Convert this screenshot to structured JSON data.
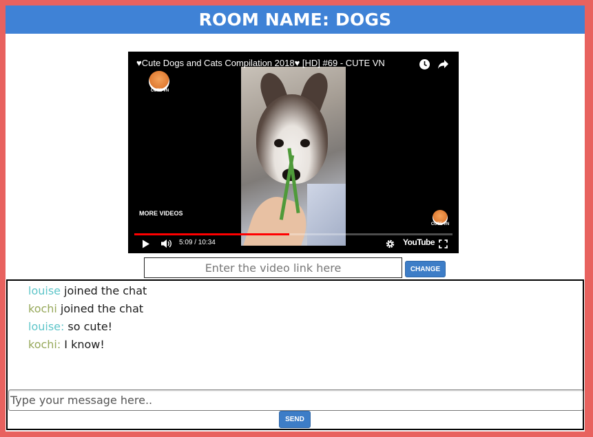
{
  "header": {
    "room_title": "ROOM NAME: DOGS"
  },
  "video": {
    "title": "♥Cute Dogs and Cats Compilation 2018♥ [HD] #69 - CUTE VN",
    "channel_logo_text": "CUTE VN",
    "watermark_text": "CUTE VN",
    "more_videos": "MORE VIDEOS",
    "time": "5:09 / 10:34",
    "progress_fraction": 0.487,
    "brand": "YouTube",
    "icons": [
      "watch-later-icon",
      "share-icon",
      "play-icon",
      "volume-icon",
      "settings-icon",
      "fullscreen-icon"
    ]
  },
  "link_form": {
    "placeholder": "Enter the video link here",
    "value": "",
    "button_label": "CHANGE"
  },
  "chat": {
    "messages": [
      {
        "user": "louise",
        "user_color": "#5ec5c9",
        "text": "joined the chat"
      },
      {
        "user": "kochi",
        "user_color": "#96a85a",
        "text": "joined the chat"
      },
      {
        "user": "louise:",
        "user_color": "#5ec5c9",
        "text": "so cute!"
      },
      {
        "user": "kochi:",
        "user_color": "#96a85a",
        "text": "I know!"
      }
    ],
    "input_placeholder": "Type your message here..",
    "input_value": "",
    "send_label": "SEND"
  },
  "colors": {
    "page_border": "#e8625f",
    "header_bg": "#3f82d6",
    "button_bg": "#3d7dc7"
  }
}
